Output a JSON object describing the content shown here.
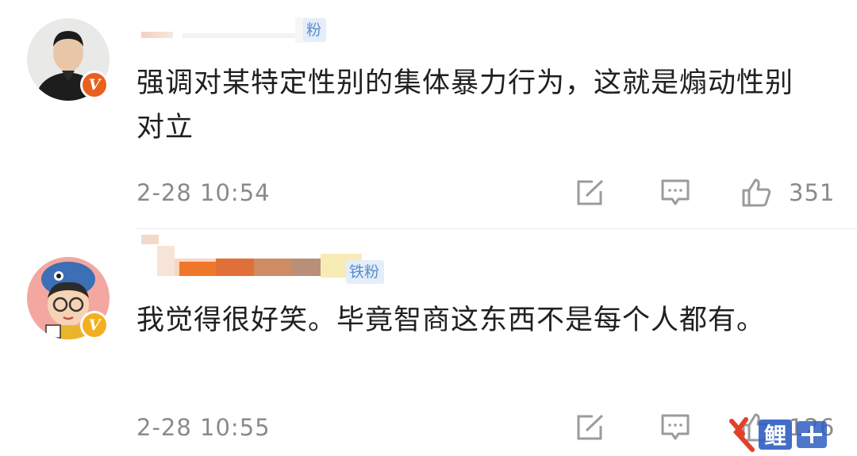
{
  "comments": [
    {
      "user_badge": "粉",
      "text": "强调对某特定性别的集体暴力行为，这就是煽动性别对立",
      "time": "2-28 10:54",
      "like_count": "351",
      "verified_color": "#e8601c"
    },
    {
      "user_badge": "铁粉",
      "text": "我觉得很好笑。毕竟智商这东西不是每个人都有。",
      "time": "2-28 10:55",
      "like_count": "126",
      "verified_color": "#f2b01e"
    }
  ],
  "icons": [
    "share-icon",
    "comment-icon",
    "like-icon"
  ],
  "watermark": {
    "text": "鲤"
  },
  "colors": {
    "text": "#202020",
    "meta": "#8a8a8a",
    "tag_bg": "#e3eefa",
    "tag_text": "#5b8dc9"
  }
}
